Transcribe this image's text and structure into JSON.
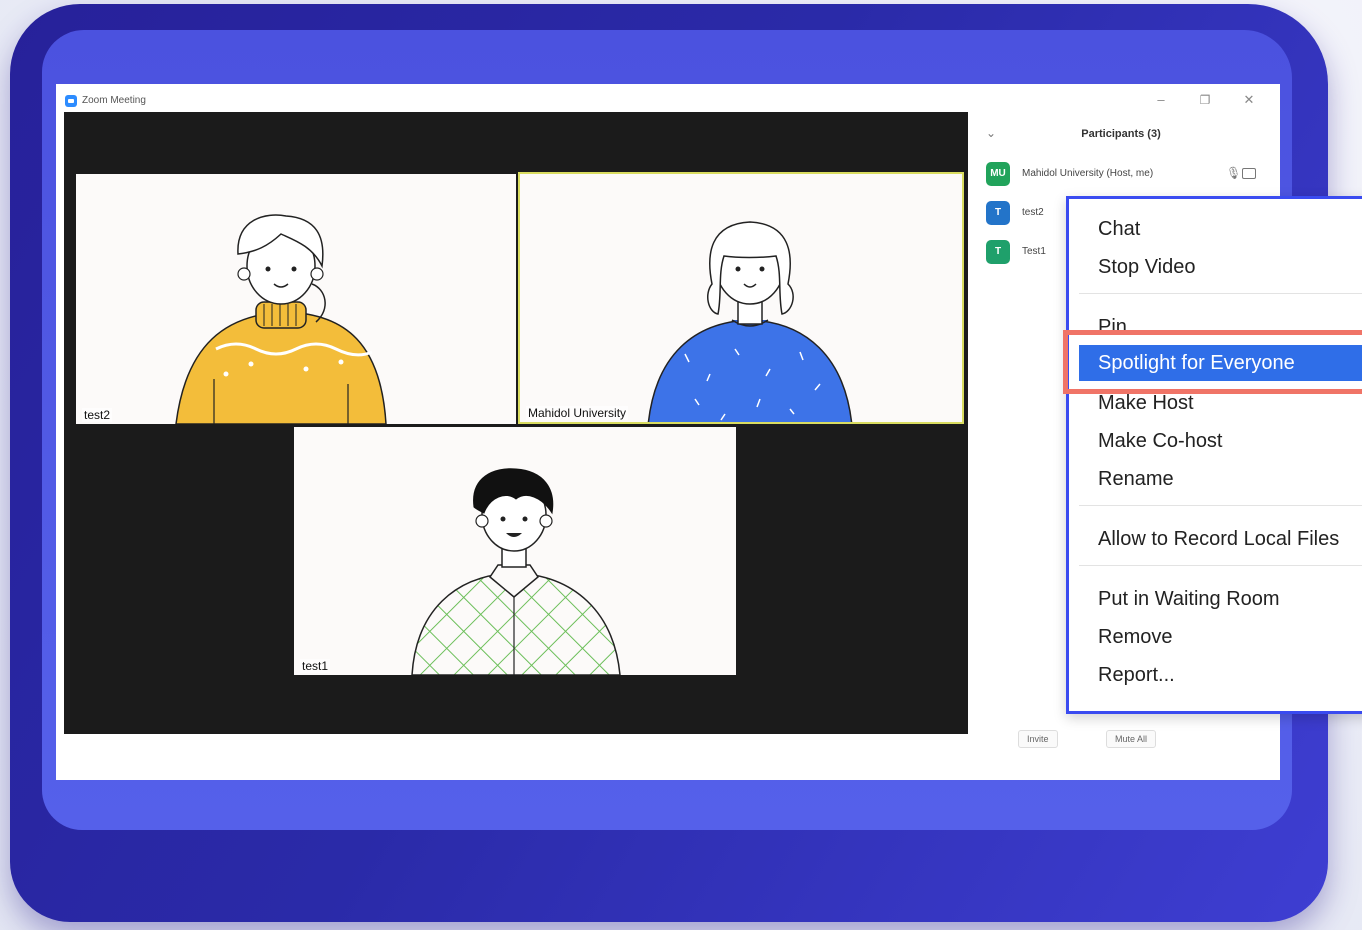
{
  "window": {
    "title": "Zoom Meeting",
    "minimize_icon": "minimize-icon",
    "maximize_icon": "restore-icon",
    "close_icon": "close-icon"
  },
  "video_tiles": [
    {
      "label": "test2"
    },
    {
      "label": "Mahidol University"
    },
    {
      "label": "test1"
    }
  ],
  "participants_panel": {
    "title": "Participants (3)",
    "collapse_glyph": "⌄",
    "participants": [
      {
        "initials": "MU",
        "name": "Mahidol University (Host, me)",
        "color": "#21a35b"
      },
      {
        "initials": "T",
        "name": "test2",
        "color": "#2374c9"
      },
      {
        "initials": "T",
        "name": "Test1",
        "color": "#1fa06b"
      }
    ],
    "invite_label": "Invite",
    "mute_all_label": "Mute All"
  },
  "context_menu": {
    "items": [
      {
        "label": "Chat"
      },
      {
        "label": "Stop Video"
      },
      {
        "label": "Pin"
      },
      {
        "label": "Spotlight for Everyone",
        "selected": true
      },
      {
        "label": "Make Host"
      },
      {
        "label": "Make Co-host"
      },
      {
        "label": "Rename"
      },
      {
        "label": "Allow to Record Local Files"
      },
      {
        "label": "Put in Waiting Room"
      },
      {
        "label": "Remove"
      },
      {
        "label": "Report..."
      }
    ]
  },
  "colors": {
    "device": "#2a2aa8",
    "menu_border": "#3a4bf0",
    "selected": "#2f6ee8",
    "highlight": "#f07467"
  }
}
